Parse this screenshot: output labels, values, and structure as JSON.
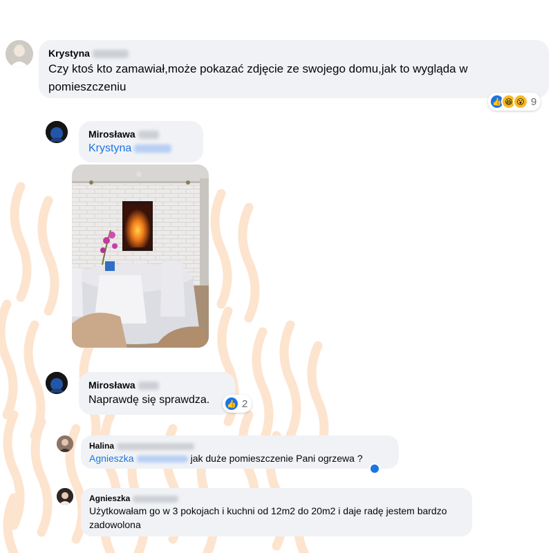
{
  "comments": [
    {
      "author": "Krystyna",
      "text": "Czy ktoś kto zamawiał,może pokazać zdjęcie ze swojego domu,jak to wygląda w pomieszczeniu",
      "reaction_count": "9",
      "reactions": [
        "like-icon",
        "haha-icon",
        "wow-icon"
      ]
    },
    {
      "author": "Mirosława",
      "mention": "Krystyna"
    },
    {
      "author": "Mirosława",
      "text": "Naprawdę się sprawdza.",
      "reaction_count": "2",
      "reactions": [
        "like-icon"
      ]
    },
    {
      "author": "Halina",
      "mention": "Agnieszka",
      "text": "jak duże pomieszczenie Pani ogrzewa ?"
    },
    {
      "author": "Agnieszka",
      "text": "Użytkowałam go w 3 pokojach i kuchni od 12m2 do 20m2 i daje radę jestem bardzo zadowolona"
    }
  ],
  "colors": {
    "bubble": "#f0f2f5",
    "mention": "#1b74e4",
    "like": "#1b74e4",
    "emoji": "#f7b928",
    "wave": "#fde2cc"
  }
}
